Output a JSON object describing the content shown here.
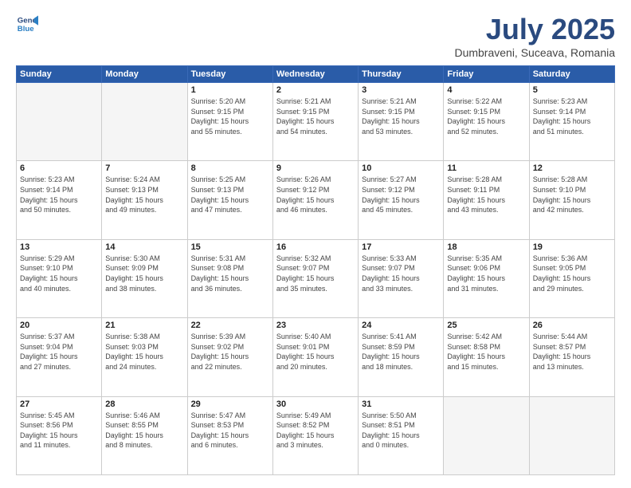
{
  "header": {
    "logo_line1": "General",
    "logo_line2": "Blue",
    "title": "July 2025",
    "subtitle": "Dumbraveni, Suceava, Romania"
  },
  "days_of_week": [
    "Sunday",
    "Monday",
    "Tuesday",
    "Wednesday",
    "Thursday",
    "Friday",
    "Saturday"
  ],
  "weeks": [
    [
      {
        "day": "",
        "empty": true
      },
      {
        "day": "",
        "empty": true
      },
      {
        "day": "1",
        "sr": "5:20 AM",
        "ss": "9:15 PM",
        "dl": "15 hours and 55 minutes."
      },
      {
        "day": "2",
        "sr": "5:21 AM",
        "ss": "9:15 PM",
        "dl": "15 hours and 54 minutes."
      },
      {
        "day": "3",
        "sr": "5:21 AM",
        "ss": "9:15 PM",
        "dl": "15 hours and 53 minutes."
      },
      {
        "day": "4",
        "sr": "5:22 AM",
        "ss": "9:15 PM",
        "dl": "15 hours and 52 minutes."
      },
      {
        "day": "5",
        "sr": "5:23 AM",
        "ss": "9:14 PM",
        "dl": "15 hours and 51 minutes."
      }
    ],
    [
      {
        "day": "6",
        "sr": "5:23 AM",
        "ss": "9:14 PM",
        "dl": "15 hours and 50 minutes."
      },
      {
        "day": "7",
        "sr": "5:24 AM",
        "ss": "9:13 PM",
        "dl": "15 hours and 49 minutes."
      },
      {
        "day": "8",
        "sr": "5:25 AM",
        "ss": "9:13 PM",
        "dl": "15 hours and 47 minutes."
      },
      {
        "day": "9",
        "sr": "5:26 AM",
        "ss": "9:12 PM",
        "dl": "15 hours and 46 minutes."
      },
      {
        "day": "10",
        "sr": "5:27 AM",
        "ss": "9:12 PM",
        "dl": "15 hours and 45 minutes."
      },
      {
        "day": "11",
        "sr": "5:28 AM",
        "ss": "9:11 PM",
        "dl": "15 hours and 43 minutes."
      },
      {
        "day": "12",
        "sr": "5:28 AM",
        "ss": "9:10 PM",
        "dl": "15 hours and 42 minutes."
      }
    ],
    [
      {
        "day": "13",
        "sr": "5:29 AM",
        "ss": "9:10 PM",
        "dl": "15 hours and 40 minutes."
      },
      {
        "day": "14",
        "sr": "5:30 AM",
        "ss": "9:09 PM",
        "dl": "15 hours and 38 minutes."
      },
      {
        "day": "15",
        "sr": "5:31 AM",
        "ss": "9:08 PM",
        "dl": "15 hours and 36 minutes."
      },
      {
        "day": "16",
        "sr": "5:32 AM",
        "ss": "9:07 PM",
        "dl": "15 hours and 35 minutes."
      },
      {
        "day": "17",
        "sr": "5:33 AM",
        "ss": "9:07 PM",
        "dl": "15 hours and 33 minutes."
      },
      {
        "day": "18",
        "sr": "5:35 AM",
        "ss": "9:06 PM",
        "dl": "15 hours and 31 minutes."
      },
      {
        "day": "19",
        "sr": "5:36 AM",
        "ss": "9:05 PM",
        "dl": "15 hours and 29 minutes."
      }
    ],
    [
      {
        "day": "20",
        "sr": "5:37 AM",
        "ss": "9:04 PM",
        "dl": "15 hours and 27 minutes."
      },
      {
        "day": "21",
        "sr": "5:38 AM",
        "ss": "9:03 PM",
        "dl": "15 hours and 24 minutes."
      },
      {
        "day": "22",
        "sr": "5:39 AM",
        "ss": "9:02 PM",
        "dl": "15 hours and 22 minutes."
      },
      {
        "day": "23",
        "sr": "5:40 AM",
        "ss": "9:01 PM",
        "dl": "15 hours and 20 minutes."
      },
      {
        "day": "24",
        "sr": "5:41 AM",
        "ss": "8:59 PM",
        "dl": "15 hours and 18 minutes."
      },
      {
        "day": "25",
        "sr": "5:42 AM",
        "ss": "8:58 PM",
        "dl": "15 hours and 15 minutes."
      },
      {
        "day": "26",
        "sr": "5:44 AM",
        "ss": "8:57 PM",
        "dl": "15 hours and 13 minutes."
      }
    ],
    [
      {
        "day": "27",
        "sr": "5:45 AM",
        "ss": "8:56 PM",
        "dl": "15 hours and 11 minutes."
      },
      {
        "day": "28",
        "sr": "5:46 AM",
        "ss": "8:55 PM",
        "dl": "15 hours and 8 minutes."
      },
      {
        "day": "29",
        "sr": "5:47 AM",
        "ss": "8:53 PM",
        "dl": "15 hours and 6 minutes."
      },
      {
        "day": "30",
        "sr": "5:49 AM",
        "ss": "8:52 PM",
        "dl": "15 hours and 3 minutes."
      },
      {
        "day": "31",
        "sr": "5:50 AM",
        "ss": "8:51 PM",
        "dl": "15 hours and 0 minutes."
      },
      {
        "day": "",
        "empty": true
      },
      {
        "day": "",
        "empty": true
      }
    ]
  ],
  "labels": {
    "sunrise": "Sunrise:",
    "sunset": "Sunset:",
    "daylight": "Daylight: "
  }
}
